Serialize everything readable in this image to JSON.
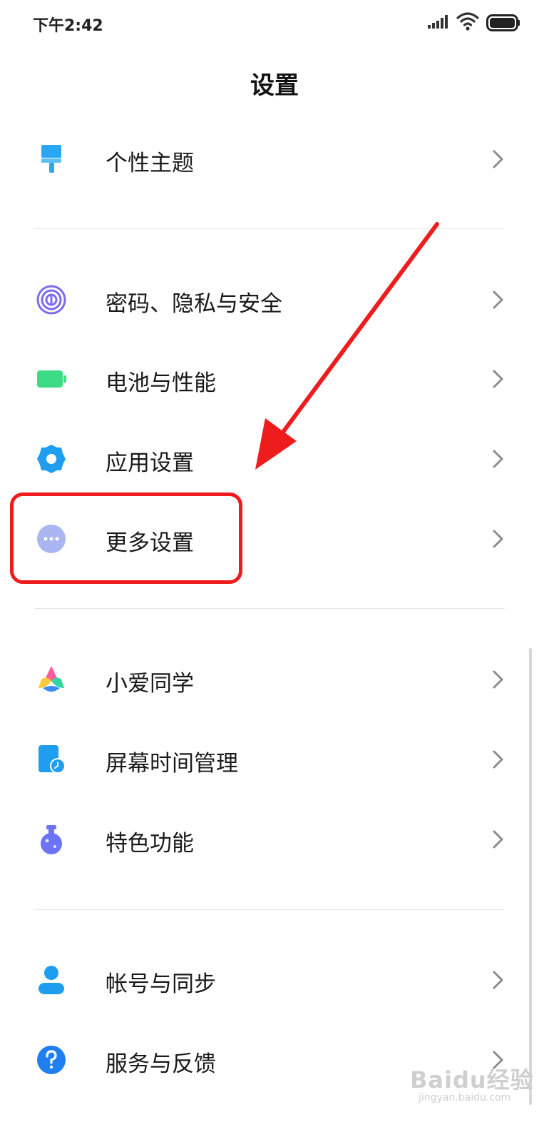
{
  "status_bar": {
    "time": "下午2:42"
  },
  "header": {
    "title": "设置"
  },
  "settings": {
    "items": [
      {
        "label": "个性主题",
        "icon": "paint-brush-icon"
      },
      {
        "label": "密码、隐私与安全",
        "icon": "fingerprint-icon"
      },
      {
        "label": "电池与性能",
        "icon": "battery-icon"
      },
      {
        "label": "应用设置",
        "icon": "gear-icon"
      },
      {
        "label": "更多设置",
        "icon": "more-dots-icon"
      },
      {
        "label": "小爱同学",
        "icon": "xiaoai-icon"
      },
      {
        "label": "屏幕时间管理",
        "icon": "screen-time-icon"
      },
      {
        "label": "特色功能",
        "icon": "flask-icon"
      },
      {
        "label": "帐号与同步",
        "icon": "person-icon"
      },
      {
        "label": "服务与反馈",
        "icon": "help-icon"
      }
    ]
  },
  "colors": {
    "theme_icon": "#29a7f4",
    "fingerprint_icon": "#7b6cf2",
    "battery_icon": "#3ddc84",
    "gear_icon": "#1f9ef0",
    "more_icon": "#a9b6f2",
    "screen_time_icon": "#1f9ef0",
    "flask_icon": "#6d74f3",
    "person_icon": "#1f9ef0",
    "help_icon": "#1f7ef0",
    "annotation": "#ee1c1c"
  },
  "watermark": {
    "brand": "Baidu经验",
    "url": "jingyan.baidu.com"
  }
}
